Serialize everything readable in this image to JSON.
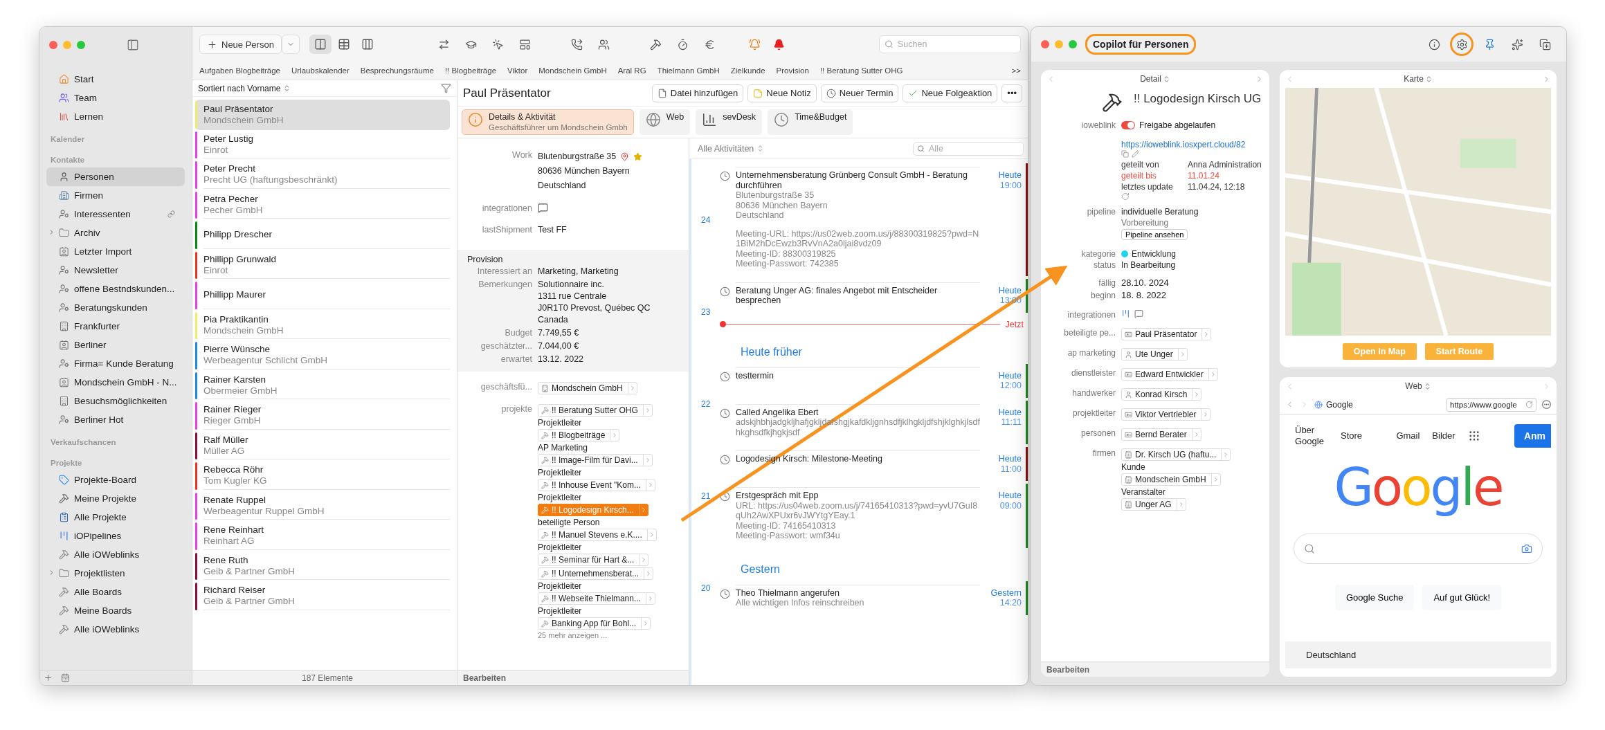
{
  "main": {
    "sidebar": {
      "top_items": [
        {
          "label": "Start",
          "kind": "home",
          "selected": false
        },
        {
          "label": "Team",
          "kind": "team",
          "selected": false
        },
        {
          "label": "Lernen",
          "kind": "books",
          "selected": false
        }
      ],
      "sections": [
        {
          "title": "Kalender"
        },
        {
          "title": "Kontakte",
          "items": [
            {
              "label": "Personen",
              "kind": "person",
              "selected": true
            },
            {
              "label": "Firmen",
              "kind": "company",
              "selected": false
            },
            {
              "label": "Interessenten",
              "kind": "smart-person",
              "selected": false,
              "shared": true
            },
            {
              "label": "Archiv",
              "kind": "folder",
              "selected": false,
              "expanded": false
            },
            {
              "label": "Letzter Import",
              "kind": "person-list",
              "selected": false
            },
            {
              "label": "Newsletter",
              "kind": "smart-person",
              "selected": false
            },
            {
              "label": "offene Bestndskunden...",
              "kind": "smart-person",
              "selected": false
            },
            {
              "label": "Beratungskunden",
              "kind": "smart-person",
              "selected": false
            },
            {
              "label": "Frankfurter",
              "kind": "company-list",
              "selected": false
            },
            {
              "label": "Berliner",
              "kind": "person-list",
              "selected": false
            },
            {
              "label": "Firma= Kunde Beratung",
              "kind": "smart-person",
              "selected": false
            },
            {
              "label": "Mondschein GmbH - N...",
              "kind": "person-list",
              "selected": false
            },
            {
              "label": "Besuchsmöglichkeiten",
              "kind": "company-list",
              "selected": false
            },
            {
              "label": "Berliner Hot",
              "kind": "smart-person",
              "selected": false
            }
          ]
        },
        {
          "title": "Verkaufschancen"
        },
        {
          "title": "Projekte",
          "items": [
            {
              "label": "Projekte-Board",
              "kind": "board",
              "selected": false
            },
            {
              "label": "Meine Projekte",
              "kind": "hammer",
              "selected": false
            },
            {
              "label": "Alle Projekte",
              "kind": "project-list",
              "selected": false
            },
            {
              "label": "iOPipelines",
              "kind": "pipeline",
              "selected": false
            },
            {
              "label": "Alle iOWeblinks",
              "kind": "smart-hammer",
              "selected": false
            },
            {
              "label": "Projektlisten",
              "kind": "folder",
              "selected": false,
              "expanded": false
            },
            {
              "label": "Alle Boards",
              "kind": "smart-hammer",
              "selected": false
            },
            {
              "label": "Meine Boards",
              "kind": "smart-hammer",
              "selected": false
            },
            {
              "label": "Alle iOWeblinks",
              "kind": "smart-hammer",
              "selected": false
            }
          ]
        }
      ]
    },
    "toolbar": {
      "new_button": "Neue Person",
      "views": [
        {
          "kind": "split",
          "selected": true
        },
        {
          "kind": "table",
          "selected": false
        },
        {
          "kind": "chart",
          "selected": false
        }
      ],
      "search_placeholder": "Suchen"
    },
    "favorites": [
      "Aufgaben Blogbeiträge",
      "Urlaubskalender",
      "Besprechungsräume",
      "!! Blogbeiträge",
      "Viktor",
      "Mondschein GmbH",
      "Aral RG",
      "Thielmann GmbH",
      "Zielkunde",
      "Provision",
      "!! Beratung Sutter OHG"
    ],
    "favorites_overflow": ">>",
    "contacts": {
      "sort_label": "Sortiert nach Vorname",
      "count": "187 Elemente",
      "rows": [
        {
          "name": "Paul Präsentator",
          "company": "Mondschein GmbH",
          "color": "#f2ea6b",
          "selected": true
        },
        {
          "name": "Peter Lustig",
          "company": "Einrot",
          "color": "#e83ee6",
          "selected": false
        },
        {
          "name": "Peter Precht",
          "company": "Precht UG (haftungsbeschränkt)",
          "color": "#e83ee6",
          "selected": false
        },
        {
          "name": "Petra Pecher",
          "company": "Pecher GmbH",
          "color": "#e83ee6",
          "selected": false
        },
        {
          "name": "Philipp Drescher",
          "color": "#0a8a0a",
          "selected": false
        },
        {
          "name": "Phillipp Grunwald",
          "company": "Einrot",
          "color": "#f0301e",
          "selected": false
        },
        {
          "name": "Phillipp Maurer",
          "color": "#e83ee6",
          "selected": false
        },
        {
          "name": "Pia Praktikantin",
          "company": "Mondschein GmbH",
          "color": "#f2ea6b",
          "selected": false
        },
        {
          "name": "Pierre Wünsche",
          "company": "Werbeagentur Schlicht GmbH",
          "color": "#1e88e5",
          "selected": false
        },
        {
          "name": "Rainer Karsten",
          "company": "Obermeier GmbH",
          "color": "#1e88e5",
          "selected": false
        },
        {
          "name": "Rainer Rieger",
          "company": "Rieger GmbH",
          "color": "#e83ee6",
          "selected": false
        },
        {
          "name": "Ralf Müller",
          "company": "Müller AG",
          "color": "#8a1038",
          "selected": false
        },
        {
          "name": "Rebecca Röhr",
          "company": "Tom Kugler KG",
          "color": "#f0301e",
          "selected": false
        },
        {
          "name": "Renate Ruppel",
          "company": "Werbeagentur Ruppel GmbH",
          "color": "#e83ee6",
          "selected": false
        },
        {
          "name": "Rene Reinhart",
          "company": "Reinhart AG",
          "color": "#e83ee6",
          "selected": false
        },
        {
          "name": "Rene Ruth",
          "company": "Geib & Partner GmbH",
          "color": "#8a1038",
          "selected": false
        },
        {
          "name": "Richard Reiser",
          "company": "Geib & Partner GmbH",
          "color": "#8a1038",
          "selected": false
        }
      ]
    },
    "detail": {
      "title": "Paul Präsentator",
      "actions": [
        {
          "label": "Datei hinzufügen",
          "kind": "file"
        },
        {
          "label": "Neue Notiz",
          "kind": "note"
        },
        {
          "label": "Neuer Termin",
          "kind": "event"
        },
        {
          "label": "Neue Folgeaktion",
          "kind": "task"
        },
        {
          "label": "•••",
          "kind": "more"
        }
      ],
      "tabs": [
        {
          "label": "Details & Aktivität",
          "sublabel": "Geschäftsführer um Mondschein Gmbh",
          "kind": "info",
          "selected": true
        },
        {
          "label": "Web",
          "kind": "web",
          "selected": false
        },
        {
          "label": "sevDesk",
          "kind": "chart",
          "selected": false
        },
        {
          "label": "Time&Budget",
          "kind": "clock",
          "selected": false
        }
      ],
      "fields": [
        {
          "kind": "address",
          "label": "Work",
          "lines": [
            "Blutenburgstraße 35",
            "80636 München Bayern",
            "Deutschland"
          ]
        },
        {
          "kind": "icons",
          "label": "integrationen"
        },
        {
          "kind": "text",
          "label": "lastShipment",
          "lines": [
            "Test FF"
          ]
        }
      ],
      "provision": {
        "title": "Provision",
        "rows": [
          {
            "label": "Interessiert an",
            "lines": [
              "Marketing, Marketing"
            ]
          },
          {
            "label": "Bemerkungen",
            "lines": [
              "Solutionnaire inc.",
              "1311 rue Centrale",
              "J0R1T0 Prevost, Québec QC",
              "Canada"
            ]
          },
          {
            "label": "Budget",
            "lines": [
              "7.749,55 €"
            ]
          },
          {
            "label": "geschätzter...",
            "lines": [
              "7.044,00 €"
            ]
          },
          {
            "label": "erwartet",
            "lines": [
              "13.12. 2022"
            ]
          }
        ]
      },
      "links": [
        {
          "label": "geschäftsfü...",
          "chips": [
            {
              "text": "Mondschein GmbH",
              "kind": "company",
              "highlighted": false
            }
          ]
        },
        {
          "label": "projekte",
          "chips": [
            {
              "text": "!! Beratung Sutter OHG",
              "kind": "project",
              "highlighted": false,
              "role": "Projektleiter"
            },
            {
              "text": "!! Blogbeiträge",
              "kind": "project",
              "highlighted": false,
              "role": "AP Marketing"
            },
            {
              "text": "!! Image-Film für Davi...",
              "kind": "project",
              "highlighted": false,
              "role": "Projektleiter"
            },
            {
              "text": "!! Inhouse Event \"Kom...",
              "kind": "project",
              "highlighted": false,
              "role": "Projektleiter"
            },
            {
              "text": "!! Logodesign Kirsch...",
              "kind": "project",
              "highlighted": true,
              "role": "beteiligte Person"
            },
            {
              "text": "!! Manuel Stevens e.K....",
              "kind": "project",
              "highlighted": false,
              "role": "Projektleiter"
            },
            {
              "text": "!! Seminar für Hart &...",
              "kind": "project",
              "highlighted": false
            },
            {
              "text": "!! Unternehmensberat...",
              "kind": "project",
              "highlighted": false,
              "role": "Projektleiter"
            },
            {
              "text": "!! Webseite Thielmann...",
              "kind": "project",
              "highlighted": false,
              "role": "Projektleiter"
            },
            {
              "text": "Banking App für Bohl...",
              "kind": "project",
              "highlighted": false
            }
          ]
        }
      ],
      "more": "25 mehr anzeigen ...",
      "footer": "Bearbeiten"
    },
    "activities": {
      "filter": "Alle Aktivitäten",
      "search_placeholder": "Alle",
      "weeks": [
        "24",
        "23",
        "22",
        "21",
        "20"
      ],
      "items": [
        {
          "kind": "event",
          "title": "Unternehmensberatung Grünberg Consult GmbH - Beratung durchführen",
          "paragraphs": [
            [
              "Blutenburgstraße 35",
              "80636 München Bayern",
              "Deutschland"
            ],
            [
              "Meeting-URL: https://us02web.zoom.us/j/88300319825?pwd=N1BiM2hDcEwzb3RvVnA2a0ljai8vdz09",
              "Meeting-ID: 88300319825",
              "Meeting-Passwort: 742385"
            ]
          ],
          "day": "Heute",
          "time": "19:00",
          "color": "#8b0f0f"
        },
        {
          "kind": "event",
          "title": "Beratung Unger AG: finales Angebot mit Entscheider besprechen",
          "day": "Heute",
          "time": "13:00",
          "color": "#1a8a1a"
        },
        {
          "kind": "now",
          "label": "Jetzt"
        },
        {
          "kind": "section",
          "label": "Heute früher"
        },
        {
          "kind": "event",
          "title": "testtermin",
          "day": "Heute",
          "time": "12:00",
          "color": "#1a8a1a"
        },
        {
          "kind": "event",
          "title": "Called Angelika Ebert",
          "paragraphs": [
            [
              "adskjhbhjadgkljhafjgkljdafshgjkafdkljgnhsdfjklhgkljdfshjklghkjlsdf hkghsdfkjhgkjsdf"
            ]
          ],
          "day": "Heute",
          "time": "11:11",
          "color": "#1a8a1a"
        },
        {
          "kind": "event",
          "title": "Logodesign Kirsch: Milestone-Meeting",
          "day": "Heute",
          "time": "11:00",
          "color": "#8b0f0f"
        },
        {
          "kind": "event",
          "title": "Erstgespräch mit Epp",
          "paragraphs": [
            [
              "URL: https://us04web.zoom.us/j/74165410313?pwd=yvU7GuI8qUh2AwXPUxr6vJWYtgYEay.1",
              "Meeting-ID: 74165410313",
              "Meeting-Passwort: wmf34u"
            ]
          ],
          "day": "Heute",
          "time": "09:00",
          "color": "#1a8a1a"
        },
        {
          "kind": "section",
          "label": "Gestern"
        },
        {
          "kind": "event",
          "title": "Theo Thielmann angerufen",
          "paragraphs": [
            [
              "Alle wichtigen Infos reinschreiben"
            ]
          ],
          "day": "Gestern",
          "time": "14:20",
          "color": "#1a8a1a"
        }
      ]
    }
  },
  "copilot": {
    "title": "Copilot für Personen",
    "title_highlighted": true,
    "tools": [
      {
        "kind": "help",
        "highlighted": false
      },
      {
        "kind": "gear",
        "highlighted": true
      },
      {
        "kind": "pin",
        "highlighted": false
      },
      {
        "kind": "sparkle",
        "highlighted": false
      },
      {
        "kind": "new-window",
        "highlighted": false
      }
    ],
    "detail": {
      "nav": "Detail",
      "title": "!! Logodesign Kirsch UG",
      "weblink": {
        "label": "ioweblink",
        "on": true,
        "status": "Freigabe abgelaufen",
        "url": "https://ioweblink.iosxpert.cloud/82",
        "rows": [
          {
            "label": "geteilt von",
            "value": "Anna Administration",
            "expired": false
          },
          {
            "label": "geteilt bis",
            "value": "11.01.24",
            "expired": true
          },
          {
            "label": "letztes update",
            "value": "11.04.24, 12:18",
            "expired": false
          }
        ]
      },
      "pipeline": {
        "label": "pipeline",
        "name": "individuelle Beratung",
        "stage": "Vorbereitung",
        "button": "Pipeline ansehen"
      },
      "category": {
        "label": "kategorie",
        "value": "Entwicklung",
        "color": "#22d3ee"
      },
      "rows": [
        {
          "label": "status",
          "value": "In Bearbeitung"
        },
        {
          "label": "fällig",
          "value": "28.10. 2024"
        },
        {
          "label": "beginn",
          "value": "18. 8. 2022"
        }
      ],
      "integrations_label": "integrationen",
      "links": [
        {
          "label": "beteiligte pe...",
          "chips": [
            {
              "text": "Paul Präsentator",
              "kind": "card"
            }
          ]
        },
        {
          "label": "ap marketing",
          "chips": [
            {
              "text": "Ute Unger",
              "kind": "person"
            }
          ]
        },
        {
          "label": "dienstleister",
          "chips": [
            {
              "text": "Edward Entwickler",
              "kind": "card"
            }
          ]
        },
        {
          "label": "handwerker",
          "chips": [
            {
              "text": "Konrad Kirsch",
              "kind": "person"
            }
          ]
        },
        {
          "label": "projektleiter",
          "chips": [
            {
              "text": "Viktor Vertriebler",
              "kind": "card"
            }
          ]
        },
        {
          "label": "personen",
          "chips": [
            {
              "text": "Bernd Berater",
              "kind": "card"
            }
          ]
        },
        {
          "label": "firmen",
          "chips": [
            {
              "text": "Dr. Kirsch UG (haftu...",
              "kind": "company",
              "role": "Kunde"
            },
            {
              "text": "Mondschein GmbH",
              "kind": "company",
              "role": "Veranstalter"
            },
            {
              "text": "Unger AG",
              "kind": "company"
            }
          ]
        }
      ],
      "footer": "Bearbeiten"
    },
    "map": {
      "nav": "Karte",
      "buttons": [
        "Open In Map",
        "Start Route"
      ]
    },
    "web": {
      "nav": "Web",
      "tab": "Google",
      "url": "https://www.google",
      "page": {
        "links": [
          "Über Google",
          "Store",
          "Gmail",
          "Bilder"
        ],
        "signin": "Anm",
        "logo": "Google",
        "buttons": [
          "Google Suche",
          "Auf gut Glück!"
        ],
        "footer": "Deutschland"
      }
    }
  }
}
